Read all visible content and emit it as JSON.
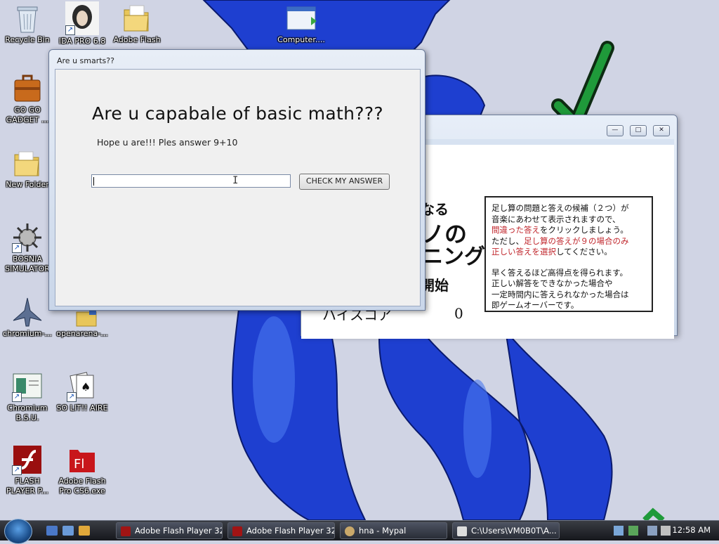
{
  "desktop": {
    "icons": [
      {
        "label": "Recycle Bin"
      },
      {
        "label": "IDA PRO 6.8"
      },
      {
        "label": "Adobe Flash"
      },
      {
        "label": "Computer...."
      },
      {
        "label": "GO GO\nGADGET ..."
      },
      {
        "label": "New Folder"
      },
      {
        "label": "BOSNIA\nSIMULATOR"
      },
      {
        "label": "chromium-..."
      },
      {
        "label": "openarena-..."
      },
      {
        "label": "Chromium\nB.S.U."
      },
      {
        "label": "SO LIT!! AIRE"
      },
      {
        "label": "FLASH\nPLAYER P..."
      },
      {
        "label": "Adobe Flash\nPro CS6.exe"
      }
    ]
  },
  "dialog": {
    "title": "Are u smarts??",
    "heading": "Are u capabale of basic math???",
    "subtext": "Hope u are!!! Ples answer 9+10",
    "answer_value": "",
    "button_label": "CHECK MY ANSWER"
  },
  "flash_window": {
    "title_buttons": {
      "minimize": "—",
      "maximize": "□",
      "close": "✕"
    },
    "partial_heading_1": "なる",
    "partial_heading_2": "ノの",
    "partial_heading_3": "ニング",
    "partial_start": "開始",
    "partial_highscore": "ハイスコア",
    "score": "0",
    "rules": {
      "l1": "足し算の問題と答えの候補（２つ）が",
      "l2": "音楽にあわせて表示されますので、",
      "l3_red": "間違った答え",
      "l3_rest": "をクリックしましょう。",
      "l4_pre": "ただし、",
      "l4_red": "足し算の答えが９の場合のみ",
      "l5_red": "正しい答えを選択",
      "l5_rest": "してください。",
      "l6": "早く答えるほど高得点を得られます。",
      "l7": "正しい解答をできなかった場合や",
      "l8": "一定時間内に答えられなかった場合は",
      "l9": "即ゲームオーバーです。"
    }
  },
  "taskbar": {
    "items": [
      {
        "label": "Adobe Flash Player 32"
      },
      {
        "label": "Adobe Flash Player 32"
      },
      {
        "label": "hna - Mypal"
      },
      {
        "label": "C:\\Users\\VM0B0T\\A..."
      }
    ],
    "clock": "12:58 AM"
  },
  "colors": {
    "figure_blue": "#1e3fd0",
    "check_green": "#1f9a3a",
    "rules_red": "#c0262c"
  }
}
